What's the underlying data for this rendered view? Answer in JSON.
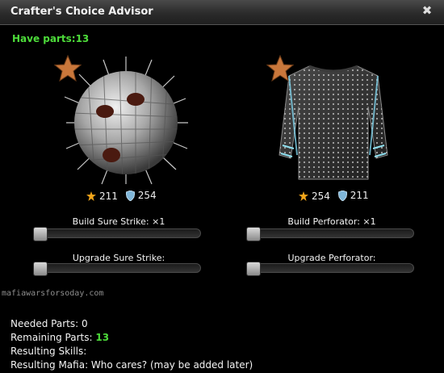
{
  "window": {
    "title": "Crafter's Choice Advisor",
    "close_glyph": "✖"
  },
  "have_parts": {
    "label": "Have parts:",
    "value": "13"
  },
  "items": [
    {
      "name": "Sure Strike",
      "icon": "spiked-ball-image",
      "attack": "211",
      "defense": "254",
      "build_label": "Build Sure Strike: ×1",
      "build_level": 0,
      "upgrade_label": "Upgrade Sure Strike:",
      "upgrade_level": 0
    },
    {
      "name": "Perforator",
      "icon": "spiked-shirt-image",
      "attack": "254",
      "defense": "211",
      "build_label": "Build Perforator: ×1",
      "build_level": 0,
      "upgrade_label": "Upgrade Perforator:",
      "upgrade_level": 0
    }
  ],
  "summary": {
    "needed_label": "Needed Parts:",
    "needed_value": "0",
    "remaining_label": "Remaining Parts:",
    "remaining_value": "13",
    "skills_label": "Resulting Skills:",
    "mafia_label": "Resulting Mafia: Who cares? (may be added later)"
  },
  "watermark": "mafiawarsforsoday.com",
  "colors": {
    "accent_green": "#4ddc3a",
    "star": "#c9773b",
    "attack": "#f2a51a",
    "defense": "#7fb6d9"
  }
}
